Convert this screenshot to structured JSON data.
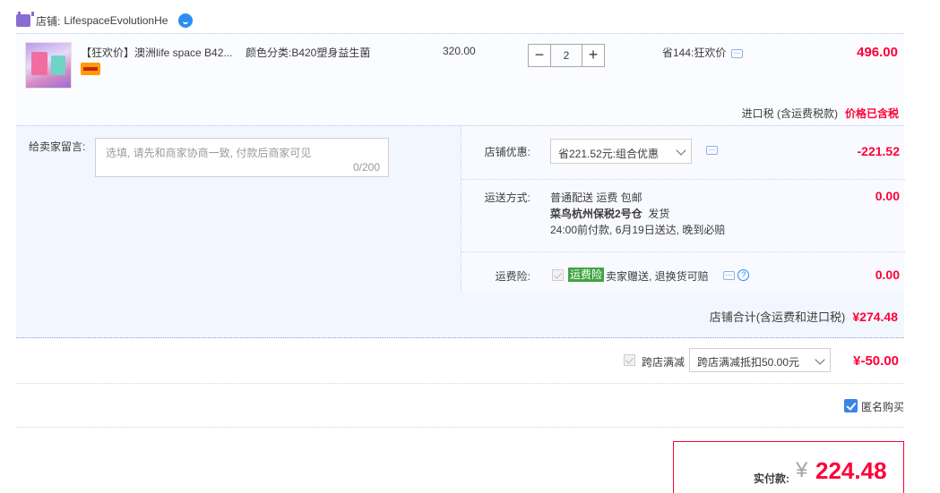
{
  "shop": {
    "label": "店铺:",
    "name": "LifespaceEvolutionHe"
  },
  "item": {
    "title": "【狂欢价】澳洲life space B42...",
    "sku": "颜色分类:B420塑身益生菌",
    "unit_price": "320.00",
    "quantity": "2",
    "qty_minus": "−",
    "qty_plus": "+",
    "saving": "省144:狂欢价",
    "total": "496.00"
  },
  "tax": {
    "label": "进口税 (含运费税款)",
    "value": "价格已含税"
  },
  "message": {
    "label": "给卖家留言:",
    "placeholder": "选填, 请先和商家协商一致, 付款后商家可见",
    "count": "0/200"
  },
  "coupon": {
    "label": "店铺优惠:",
    "selected": "省221.52元:组合优惠",
    "amount": "-221.52"
  },
  "shipping": {
    "label": "运送方式:",
    "method": "普通配送 运费 包邮",
    "warehouse": "菜鸟杭州保税2号仓",
    "warehouse_suffix": "发货",
    "eta": "24:00前付款, 6月19日送达, 晚到必赔",
    "amount": "0.00"
  },
  "insurance": {
    "label": "运费险:",
    "badge": "运费险",
    "text": "卖家赠送, 退换货可赔",
    "help": "?",
    "amount": "0.00"
  },
  "shop_total": {
    "label": "店铺合计(含运费和进口税)",
    "value": "¥274.48"
  },
  "cross_store": {
    "label": "跨店满减",
    "selected": "跨店满减抵扣50.00元",
    "amount": "¥-50.00"
  },
  "anonymous": {
    "label": "匿名购买",
    "checked": true
  },
  "payment": {
    "label": "实付款:",
    "symbol": "¥",
    "value": "224.48"
  },
  "colors": {
    "price_red": "#ff0036",
    "accent_blue": "#3a85e8",
    "insurance_green": "#41a441"
  }
}
